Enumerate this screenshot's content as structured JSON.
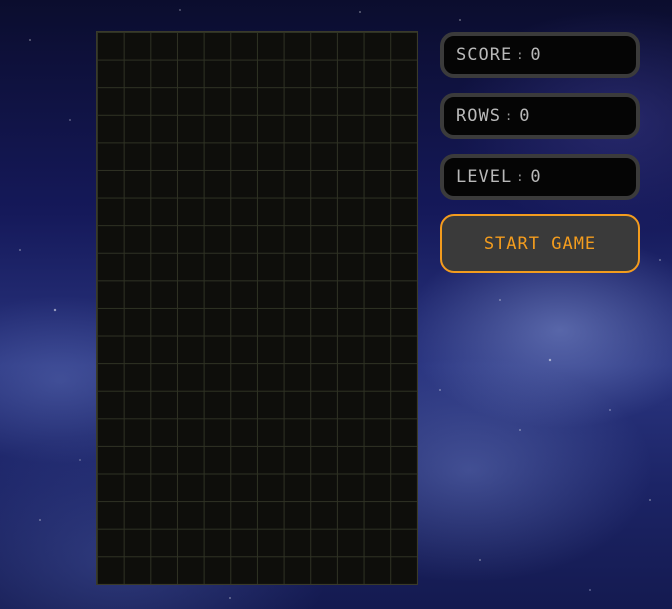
{
  "stats": {
    "score": {
      "label": "SCORE",
      "sep": ":",
      "value": "0"
    },
    "rows": {
      "label": "ROWS",
      "sep": ":",
      "value": "0"
    },
    "level": {
      "label": "LEVEL",
      "sep": ":",
      "value": "0"
    }
  },
  "controls": {
    "start_label": "START GAME"
  },
  "board": {
    "columns": 12,
    "rows": 20
  },
  "colors": {
    "accent": "#f39c1e",
    "panel_border": "#3b3b3b",
    "panel_bg": "#050505",
    "board_bg": "#0e0e0b",
    "grid_line": "#2f3224"
  }
}
